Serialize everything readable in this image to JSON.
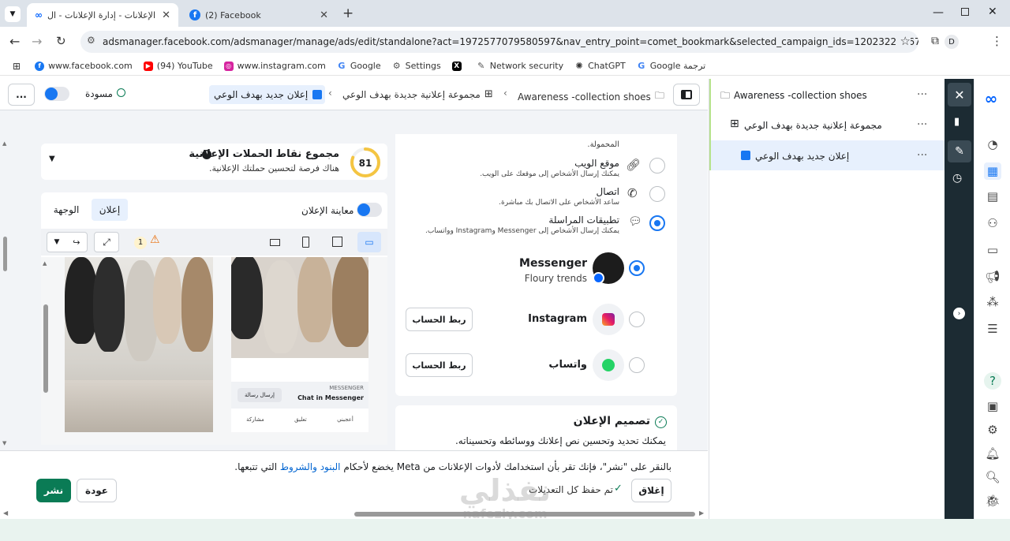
{
  "browser": {
    "tabs": [
      {
        "title": "مدير الإعلانات - إدارة الإعلانات - ال",
        "active": true
      },
      {
        "title": "(2) Facebook",
        "active": false
      }
    ],
    "new_tab_label": "+",
    "url": "adsmanager.facebook.com/adsmanager/manage/ads/edit/standalone?act=1972577079580597&nav_entry_point=comet_bookmark&selected_campaign_ids=120232271673600530&selected_a...",
    "profile_initial": "D",
    "bookmarks": [
      {
        "label": "www.facebook.com",
        "icon": "facebook-icon"
      },
      {
        "label": "(94) YouTube",
        "icon": "youtube-icon"
      },
      {
        "label": "www.instagram.com",
        "icon": "instagram-icon"
      },
      {
        "label": "Google",
        "icon": "google-icon"
      },
      {
        "label": "Settings",
        "icon": "gear-icon"
      },
      {
        "label": "",
        "icon": "x-icon"
      },
      {
        "label": "Network security",
        "icon": "pin-icon"
      },
      {
        "label": "ChatGPT",
        "icon": "chatgpt-icon"
      },
      {
        "label": "Google ترجمة",
        "icon": "translate-icon"
      }
    ]
  },
  "topbar": {
    "breadcrumb": {
      "campaign": "Awareness -collection shoes",
      "adset": "مجموعة إعلانية جديدة بهدف الوعي",
      "ad": "إعلان جديد بهدف الوعي"
    },
    "status": "مسودة",
    "more": "..."
  },
  "score": {
    "value": "81",
    "title": "مجموع نقاط الحملات الإعلانية",
    "subtitle": "هناك فرصة لتحسين حملتك الإعلانية.",
    "fraction": 0.81
  },
  "preview": {
    "toggle_label": "معاينة الإعلان",
    "tab_ad": "إعلان",
    "tab_destination": "الوجهة",
    "warning_count": "1",
    "cta_small_label": "MESSENGER",
    "cta_small_title": "Chat in Messenger",
    "cta_small_button": "إرسال رسالة",
    "actions": [
      "أعجبني",
      "تعليق",
      "مشاركة"
    ]
  },
  "destination": {
    "truncated_top": "المحمولة.",
    "options": [
      {
        "title": "موقع الويب",
        "desc": "يمكنك إرسال الأشخاص إلى موقعك على الويب.",
        "selected": false,
        "icon": "link-icon"
      },
      {
        "title": "اتصال",
        "desc": "ساعد الأشخاص على الاتصال بك مباشرة.",
        "selected": false,
        "icon": "phone-icon"
      },
      {
        "title": "تطبيقات المراسلة",
        "desc": "يمكنك إرسال الأشخاص إلى Messenger وInstagram وواتساب.",
        "selected": true,
        "icon": "chat-icon"
      }
    ],
    "apps": [
      {
        "name": "Messenger",
        "sub": "Floury trends",
        "selected": true
      },
      {
        "name": "Instagram",
        "button": "ربط الحساب",
        "selected": false
      },
      {
        "name": "واتساب",
        "button": "ربط الحساب",
        "selected": false
      }
    ]
  },
  "design": {
    "title": "تصميم الإعلان",
    "desc": "يمكنك تحديد وتحسين نص إعلانك ووسائطه وتحسيناته."
  },
  "footer": {
    "terms_prefix": "بالنقر على \"نشر\"، فإنك تقر بأن استخدامك لأدوات الإعلانات من Meta يخضع لأحكام",
    "terms_link": "البنود والشروط",
    "terms_suffix": "التي تتبعها.",
    "close": "إغلاق",
    "saved": "تم حفظ كل التعديلات",
    "back": "عودة",
    "publish": "نشر"
  },
  "tree": {
    "campaign": "Awareness -collection shoes",
    "adset": "مجموعة إعلانية جديدة بهدف الوعي",
    "ad": "إعلان جديد بهدف الوعي",
    "more": "..."
  },
  "watermark": {
    "arabic": "نفذلي",
    "latin": "nafezly.com"
  },
  "colors": {
    "accent": "#1877f2",
    "publish": "#0a7b55",
    "dark_rail": "#1c2b33"
  }
}
